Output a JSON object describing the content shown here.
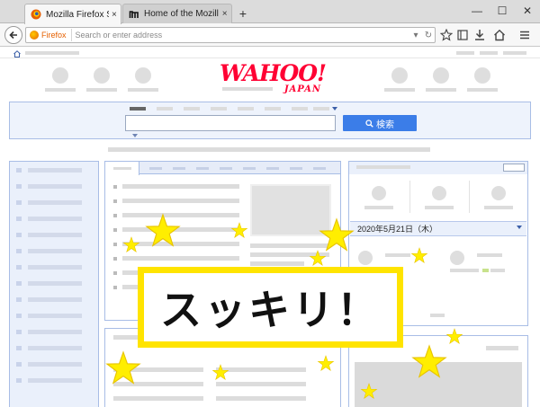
{
  "browser": {
    "tabs": [
      {
        "title": "Mozilla Firefox Start Page",
        "active": true,
        "icon": "firefox-icon"
      },
      {
        "title": "Home of the Mozilla Proje...",
        "active": false,
        "icon": "mozilla-m-icon"
      }
    ],
    "new_tab_symbol": "+",
    "close_symbol": "×",
    "window_controls": {
      "minimize": "—",
      "maximize": "☐",
      "close": "✕"
    },
    "urlbar": {
      "identity_label": "Firefox",
      "placeholder": "Search or enter address",
      "dropdown_symbol": "▾",
      "reload_symbol": "↻"
    }
  },
  "page": {
    "logo": {
      "main": "WAHOO!",
      "sub": "JAPAN"
    },
    "search": {
      "button_label": "検索"
    },
    "date_header": "2020年5月21日（木）"
  },
  "overlay": {
    "banner_text": "スッキリ！",
    "accent_color": "#ffe400",
    "star_color": "#ffee00"
  },
  "colors": {
    "brand_red": "#ff0033",
    "search_button": "#3b7de8",
    "panel_border": "#a8bde6",
    "panel_fill": "#eef3fc"
  }
}
